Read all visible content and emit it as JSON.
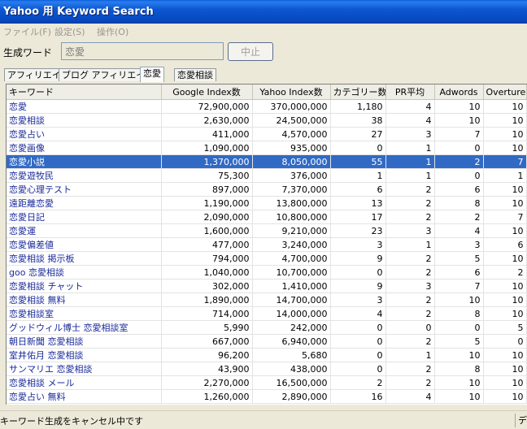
{
  "window": {
    "title": "Yahoo 用 Keyword Search"
  },
  "menu": [
    {
      "label": "ファイル(F)"
    },
    {
      "label": "設定(S)"
    },
    {
      "label": "操作(O)"
    }
  ],
  "generator": {
    "label": "生成ワード",
    "value": "恋愛",
    "stop_label": "中止"
  },
  "tabs": [
    {
      "label": "アフィリエイト"
    },
    {
      "label": "ブログ アフィリエイト"
    },
    {
      "label": "恋愛"
    },
    {
      "label": "恋愛相談"
    }
  ],
  "table": {
    "columns": [
      "キーワード",
      "Google Index数",
      "Yahoo Index数",
      "カテゴリー数",
      "PR平均",
      "Adwords",
      "Overture"
    ],
    "selected_row": 4,
    "rows": [
      [
        "恋愛",
        "72,900,000",
        "370,000,000",
        "1,180",
        "4",
        "10",
        "10"
      ],
      [
        "恋愛相談",
        "2,630,000",
        "24,500,000",
        "38",
        "4",
        "10",
        "10"
      ],
      [
        "恋愛占い",
        "411,000",
        "4,570,000",
        "27",
        "3",
        "7",
        "10"
      ],
      [
        "恋愛画像",
        "1,090,000",
        "935,000",
        "0",
        "1",
        "0",
        "10"
      ],
      [
        "恋愛小説",
        "1,370,000",
        "8,050,000",
        "55",
        "1",
        "2",
        "7"
      ],
      [
        "恋愛遊牧民",
        "75,300",
        "376,000",
        "1",
        "1",
        "0",
        "1"
      ],
      [
        "恋愛心理テスト",
        "897,000",
        "7,370,000",
        "6",
        "2",
        "6",
        "10"
      ],
      [
        "遠距離恋愛",
        "1,190,000",
        "13,800,000",
        "13",
        "2",
        "8",
        "10"
      ],
      [
        "恋愛日記",
        "2,090,000",
        "10,800,000",
        "17",
        "2",
        "2",
        "7"
      ],
      [
        "恋愛運",
        "1,600,000",
        "9,210,000",
        "23",
        "3",
        "4",
        "10"
      ],
      [
        "恋愛偏差値",
        "477,000",
        "3,240,000",
        "3",
        "1",
        "3",
        "6"
      ],
      [
        "恋愛相談 掲示板",
        "794,000",
        "4,700,000",
        "9",
        "2",
        "5",
        "10"
      ],
      [
        "goo 恋愛相談",
        "1,040,000",
        "10,700,000",
        "0",
        "2",
        "6",
        "2"
      ],
      [
        "恋愛相談 チャット",
        "302,000",
        "1,410,000",
        "9",
        "3",
        "7",
        "10"
      ],
      [
        "恋愛相談 無料",
        "1,890,000",
        "14,700,000",
        "3",
        "2",
        "10",
        "10"
      ],
      [
        "恋愛相談室",
        "714,000",
        "14,000,000",
        "4",
        "2",
        "8",
        "10"
      ],
      [
        "グッドウィル博士 恋愛相談室",
        "5,990",
        "242,000",
        "0",
        "0",
        "0",
        "5"
      ],
      [
        "朝日新聞 恋愛相談",
        "667,000",
        "6,940,000",
        "0",
        "2",
        "5",
        "0"
      ],
      [
        "室井佑月 恋愛相談",
        "96,200",
        "5,680",
        "0",
        "1",
        "10",
        "10"
      ],
      [
        "サンマリエ 恋愛相談",
        "43,900",
        "438,000",
        "0",
        "2",
        "8",
        "10"
      ],
      [
        "恋愛相談 メール",
        "2,270,000",
        "16,500,000",
        "2",
        "2",
        "10",
        "10"
      ],
      [
        "恋愛占い 無料",
        "1,260,000",
        "2,890,000",
        "16",
        "4",
        "10",
        "10"
      ]
    ]
  },
  "status": {
    "text": "キーワード生成をキャンセル中です",
    "right": "デ"
  }
}
